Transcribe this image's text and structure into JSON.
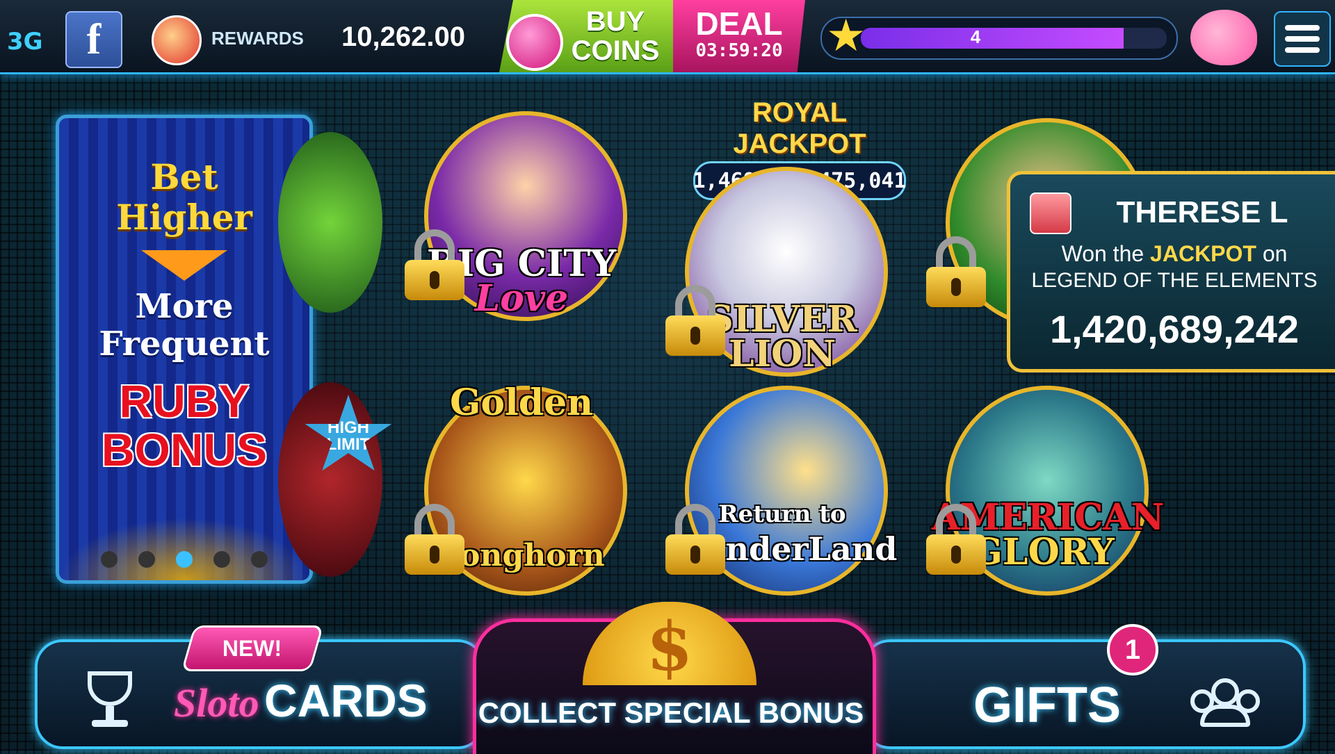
{
  "topbar": {
    "network": "3G",
    "facebook_icon": "f",
    "rewards_label": "REWARDS",
    "balance": "10,262.00",
    "buy_coins": [
      "BUY",
      "COINS"
    ],
    "deal_label": "DEAL",
    "deal_timer": "03:59:20",
    "level": "4",
    "level_progress_fraction": 0.86
  },
  "promo": {
    "line1": "Bet",
    "line2": "Higher",
    "line3": "More",
    "line4": "Frequent",
    "line5": "RUBY",
    "line6": "BONUS",
    "carousel_pages": 5,
    "carousel_active_index": 2
  },
  "side_tiles": {
    "high_limit": [
      "HIGH",
      "LIMIT"
    ]
  },
  "royal_jackpot": {
    "label": "ROYAL JACKPOT",
    "value": "1,469,547,475,041"
  },
  "games": [
    {
      "title": "BIG CITY",
      "subtitle": "Love",
      "locked": true
    },
    {
      "title": "SILVER",
      "subtitle": "LION",
      "locked": true
    },
    {
      "title": "",
      "subtitle": "",
      "locked": true
    },
    {
      "title": "Golden",
      "subtitle": "Longhorn",
      "locked": true
    },
    {
      "title": "Return to",
      "subtitle": "WonderLand",
      "locked": true
    },
    {
      "title": "AMERICAN",
      "subtitle": "GLORY",
      "locked": true
    }
  ],
  "notification": {
    "name": "THERESE L",
    "won_prefix": "Won the",
    "won_highlight": "JACKPOT",
    "won_suffix": "on",
    "game": "LEGEND OF THE ELEMENTS",
    "amount": "1,420,689,242"
  },
  "bottom": {
    "new_badge": "NEW!",
    "sloto_label": "Sloto",
    "cards_label": "CARDS",
    "coin_symbol": "$",
    "collect_label": "COLLECT SPECIAL BONUS",
    "gifts_label": "GIFTS",
    "gifts_count": "1"
  },
  "colors": {
    "accent_cyan": "#3bc8ff",
    "accent_pink": "#ff2f9e",
    "gold": "#ffd84a",
    "ruby_red": "#e8101f"
  },
  "icons": [
    "network-icon",
    "facebook-icon",
    "rewards-icon",
    "gift-icon",
    "star-icon",
    "piggy-bank-icon",
    "menu-icon",
    "lock-icon",
    "trophy-icon",
    "coin-icon",
    "friends-icon"
  ]
}
